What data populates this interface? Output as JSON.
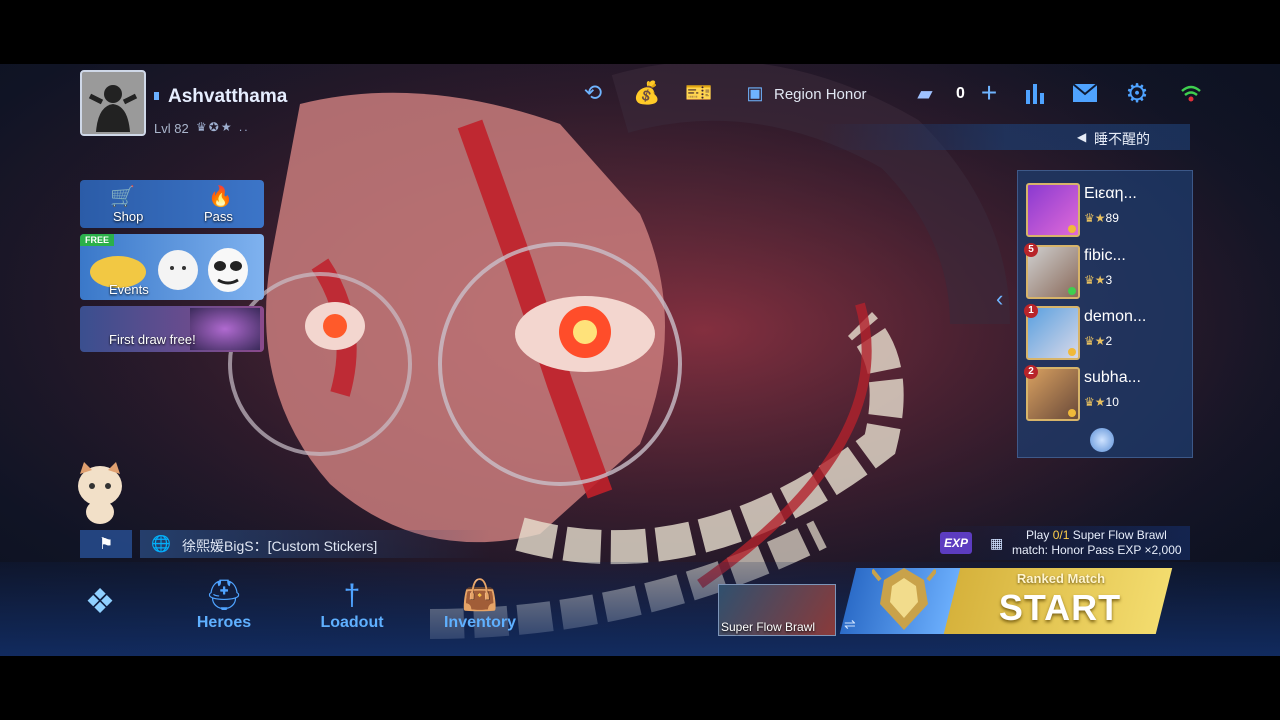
{
  "player": {
    "name": "Ashvatthama",
    "level": "Lvl 82"
  },
  "topbar": {
    "region_honor_label": "Region Honor",
    "ticket_count": "0",
    "marquee_text": "睡不醒的"
  },
  "side_menu": {
    "shop_label": "Shop",
    "pass_label": "Pass",
    "free_badge": "FREE",
    "events_label": "Events",
    "draw_label": "First draw free!"
  },
  "friends": [
    {
      "name": "Ειεαη...",
      "stars": "89",
      "badge": "",
      "online": "#f0b93a"
    },
    {
      "name": "fibic...",
      "stars": "3",
      "badge": "5",
      "online": "#3fcf4f"
    },
    {
      "name": "demon...",
      "stars": "2",
      "badge": "1",
      "online": "#f0b93a"
    },
    {
      "name": "subha...",
      "stars": "10",
      "badge": "2",
      "online": "#f0b93a"
    }
  ],
  "chat": {
    "message": "徐熙媛BigS：[Custom Stickers]"
  },
  "nav": {
    "heroes": "Heroes",
    "loadout": "Loadout",
    "inventory": "Inventory"
  },
  "quest": {
    "exp_tag": "EXP",
    "prefix": "Play ",
    "progress": "0/1",
    "suffix": " Super Flow Brawl",
    "line2": "match: Honor Pass EXP ×2,000"
  },
  "mode": {
    "label": "Super Flow Brawl"
  },
  "start": {
    "title": "Ranked Match",
    "label": "START"
  },
  "colors": {
    "accent": "#4fa3ff",
    "start": "#e8c74f",
    "rank_blue": "#2c6cc8"
  }
}
